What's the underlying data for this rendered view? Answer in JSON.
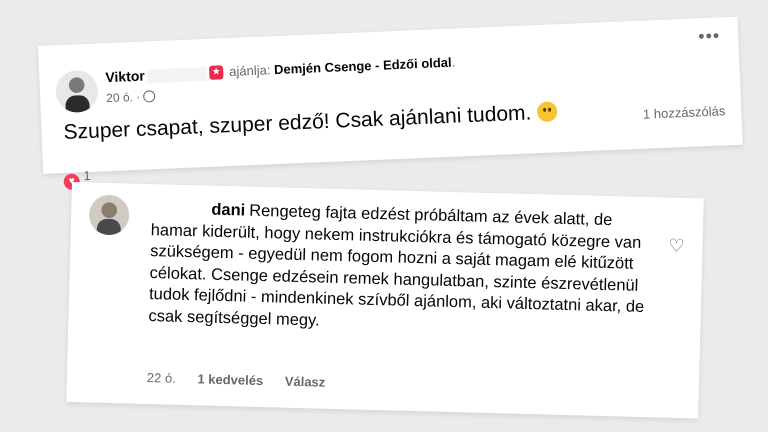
{
  "recommendation_post": {
    "author": "Viktor",
    "recommend_text": "ajánlja:",
    "page_name": "Demjén Csenge - Edzői oldal",
    "page_suffix": ".",
    "time": "20 ó. ·",
    "text": "Szuper csapat, szuper edző! Csak ajánlani tudom.",
    "comments_count": "1 hozzászólás",
    "reaction_count": "1",
    "icons": [
      "more-options-icon",
      "globe-icon",
      "recommend-icon",
      "heart-reaction-icon",
      "smiley-emoji-icon"
    ]
  },
  "comment": {
    "author": "dani",
    "text": "Rengeteg fajta edzést próbáltam az évek alatt, de hamar kiderült, hogy nekem instrukciókra és támogató közegre van szükségem - egyedül nem fogom hozni a saját magam elé kitűzött célokat. Csenge edzésein remek hangulatban, szinte észrevétlenül tudok fejlődni - mindenkinek szívből ajánlom, aki változtatni akar, de csak segítséggel megy.",
    "time": "22 ó.",
    "likes": "1 kedvelés",
    "reply": "Válasz"
  },
  "colors": {
    "background": "#ebebeb",
    "secondary_text": "#65676b",
    "heart": "#f33e58",
    "recommend": "#f02849"
  }
}
